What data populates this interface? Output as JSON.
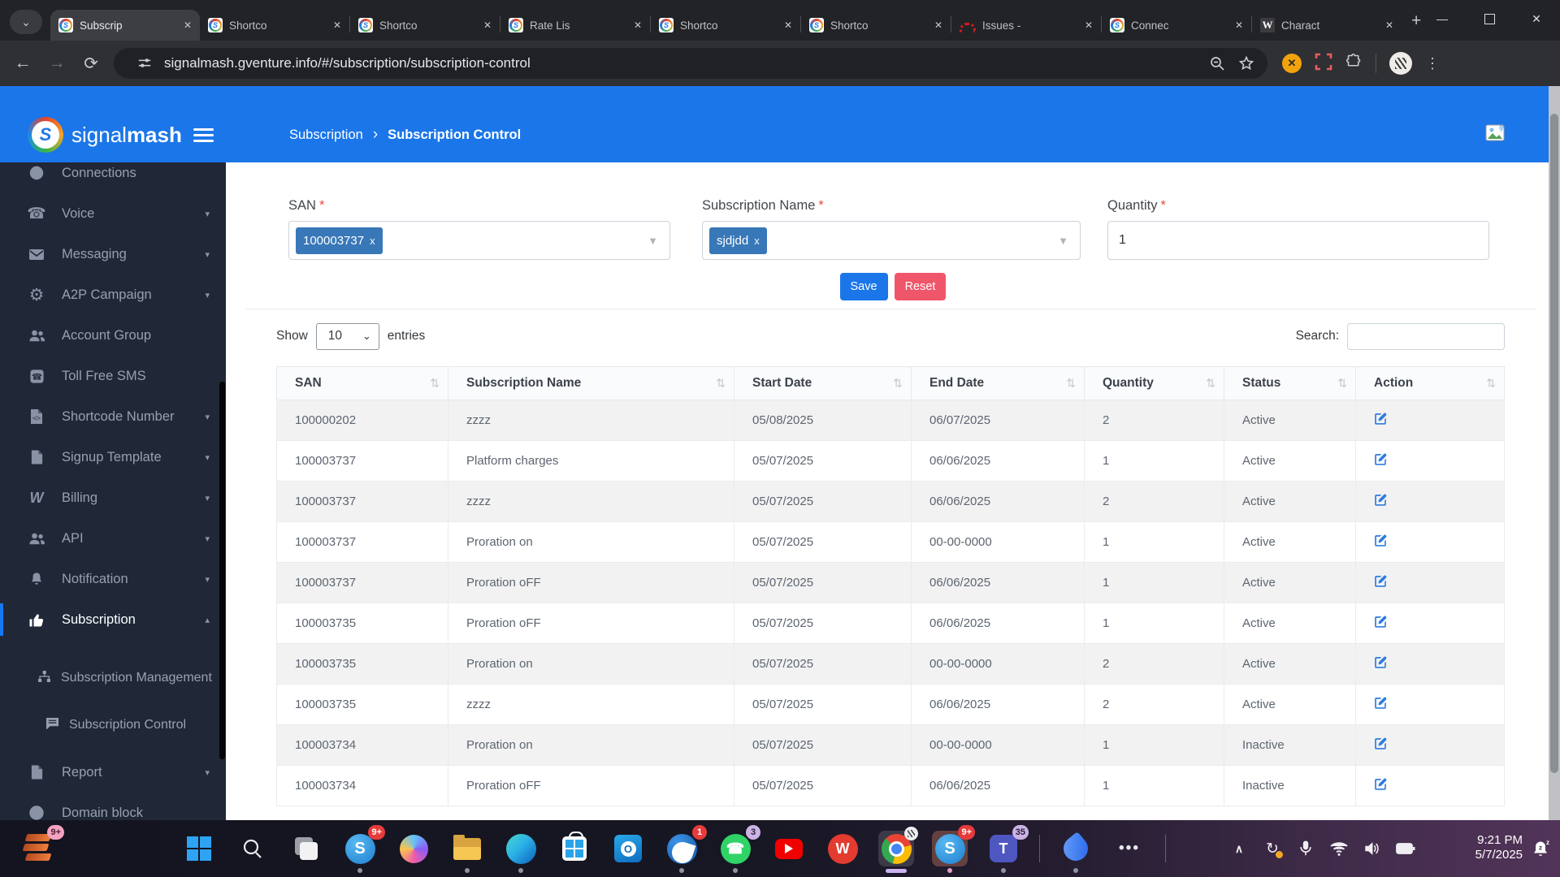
{
  "browser": {
    "tab_search_glyph": "⌄",
    "tabs": [
      {
        "title": "Subscrip",
        "favicon": "signalmash"
      },
      {
        "title": "Shortco",
        "favicon": "signalmash"
      },
      {
        "title": "Shortco",
        "favicon": "signalmash"
      },
      {
        "title": "Rate Lis",
        "favicon": "signalmash"
      },
      {
        "title": "Shortco",
        "favicon": "signalmash"
      },
      {
        "title": "Shortco",
        "favicon": "signalmash"
      },
      {
        "title": "Issues -",
        "favicon": "redmine"
      },
      {
        "title": "Connec",
        "favicon": "signalmash"
      },
      {
        "title": "Charact",
        "favicon": "wikipedia"
      }
    ],
    "new_tab": "+",
    "url": "signalmash.gventure.info/#/subscription/subscription-control",
    "window": {
      "minimize": "—",
      "close": "✕"
    }
  },
  "icons": {
    "close": "✕",
    "caret_down": "▾",
    "caret_up": "▴",
    "select_caret": "▼",
    "entries_caret": "⌄",
    "sort": "⇅",
    "breadcrumb_chevron": "›",
    "ellipsis": "•••",
    "tray_chevron": "∧",
    "sync": "↻",
    "phone": "☎",
    "gear": "⚙",
    "billing_w": "W",
    "kebab": "⋮"
  },
  "app": {
    "brand": {
      "name_light": "signal",
      "name_bold": "mash"
    },
    "breadcrumb": {
      "parent": "Subscription",
      "current": "Subscription Control"
    },
    "sidebar": {
      "items": [
        {
          "label": "Connections"
        },
        {
          "label": "Voice"
        },
        {
          "label": "Messaging"
        },
        {
          "label": "A2P Campaign"
        },
        {
          "label": "Account Group"
        },
        {
          "label": "Toll Free SMS"
        },
        {
          "label": "Shortcode Number"
        },
        {
          "label": "Signup Template"
        },
        {
          "label": "Billing"
        },
        {
          "label": "API"
        },
        {
          "label": "Notification"
        },
        {
          "label": "Subscription"
        },
        {
          "label": "Subscription Management"
        },
        {
          "label": "Subscription Control"
        },
        {
          "label": "Report"
        },
        {
          "label": "Domain block"
        }
      ]
    },
    "form": {
      "san_label": "SAN",
      "subscription_label": "Subscription Name",
      "quantity_label": "Quantity",
      "required": "*",
      "san_value": "100003737",
      "san_remove": "x",
      "subscription_value": "sjdjdd",
      "subscription_remove": "x",
      "quantity_value": "1",
      "save": "Save",
      "reset": "Reset"
    },
    "controls": {
      "show": "Show",
      "page_size": "10",
      "entries": "entries",
      "search": "Search:"
    },
    "table": {
      "headers": [
        "SAN",
        "Subscription Name",
        "Start Date",
        "End Date",
        "Quantity",
        "Status",
        "Action"
      ],
      "rows": [
        {
          "san": "100000202",
          "name": "zzzz",
          "start": "05/08/2025",
          "end": "06/07/2025",
          "qty": "2",
          "status": "Active"
        },
        {
          "san": "100003737",
          "name": "Platform charges",
          "start": "05/07/2025",
          "end": "06/06/2025",
          "qty": "1",
          "status": "Active"
        },
        {
          "san": "100003737",
          "name": "zzzz",
          "start": "05/07/2025",
          "end": "06/06/2025",
          "qty": "2",
          "status": "Active"
        },
        {
          "san": "100003737",
          "name": "Proration on",
          "start": "05/07/2025",
          "end": "00-00-0000",
          "qty": "1",
          "status": "Active"
        },
        {
          "san": "100003737",
          "name": "Proration oFF",
          "start": "05/07/2025",
          "end": "06/06/2025",
          "qty": "1",
          "status": "Active"
        },
        {
          "san": "100003735",
          "name": "Proration oFF",
          "start": "05/07/2025",
          "end": "06/06/2025",
          "qty": "1",
          "status": "Active"
        },
        {
          "san": "100003735",
          "name": "Proration on",
          "start": "05/07/2025",
          "end": "00-00-0000",
          "qty": "2",
          "status": "Active"
        },
        {
          "san": "100003735",
          "name": "zzzz",
          "start": "05/07/2025",
          "end": "06/06/2025",
          "qty": "2",
          "status": "Active"
        },
        {
          "san": "100003734",
          "name": "Proration on",
          "start": "05/07/2025",
          "end": "00-00-0000",
          "qty": "1",
          "status": "Inactive"
        },
        {
          "san": "100003734",
          "name": "Proration oFF",
          "start": "05/07/2025",
          "end": "06/06/2025",
          "qty": "1",
          "status": "Inactive"
        }
      ]
    }
  },
  "taskbar": {
    "badges": {
      "stack": "9+",
      "skype": "9+",
      "thunderbird": "1",
      "whatsapp": "3",
      "skype2": "9+",
      "teams": "35"
    },
    "tray": {
      "time": "9:21 PM",
      "date": "5/7/2025"
    }
  }
}
